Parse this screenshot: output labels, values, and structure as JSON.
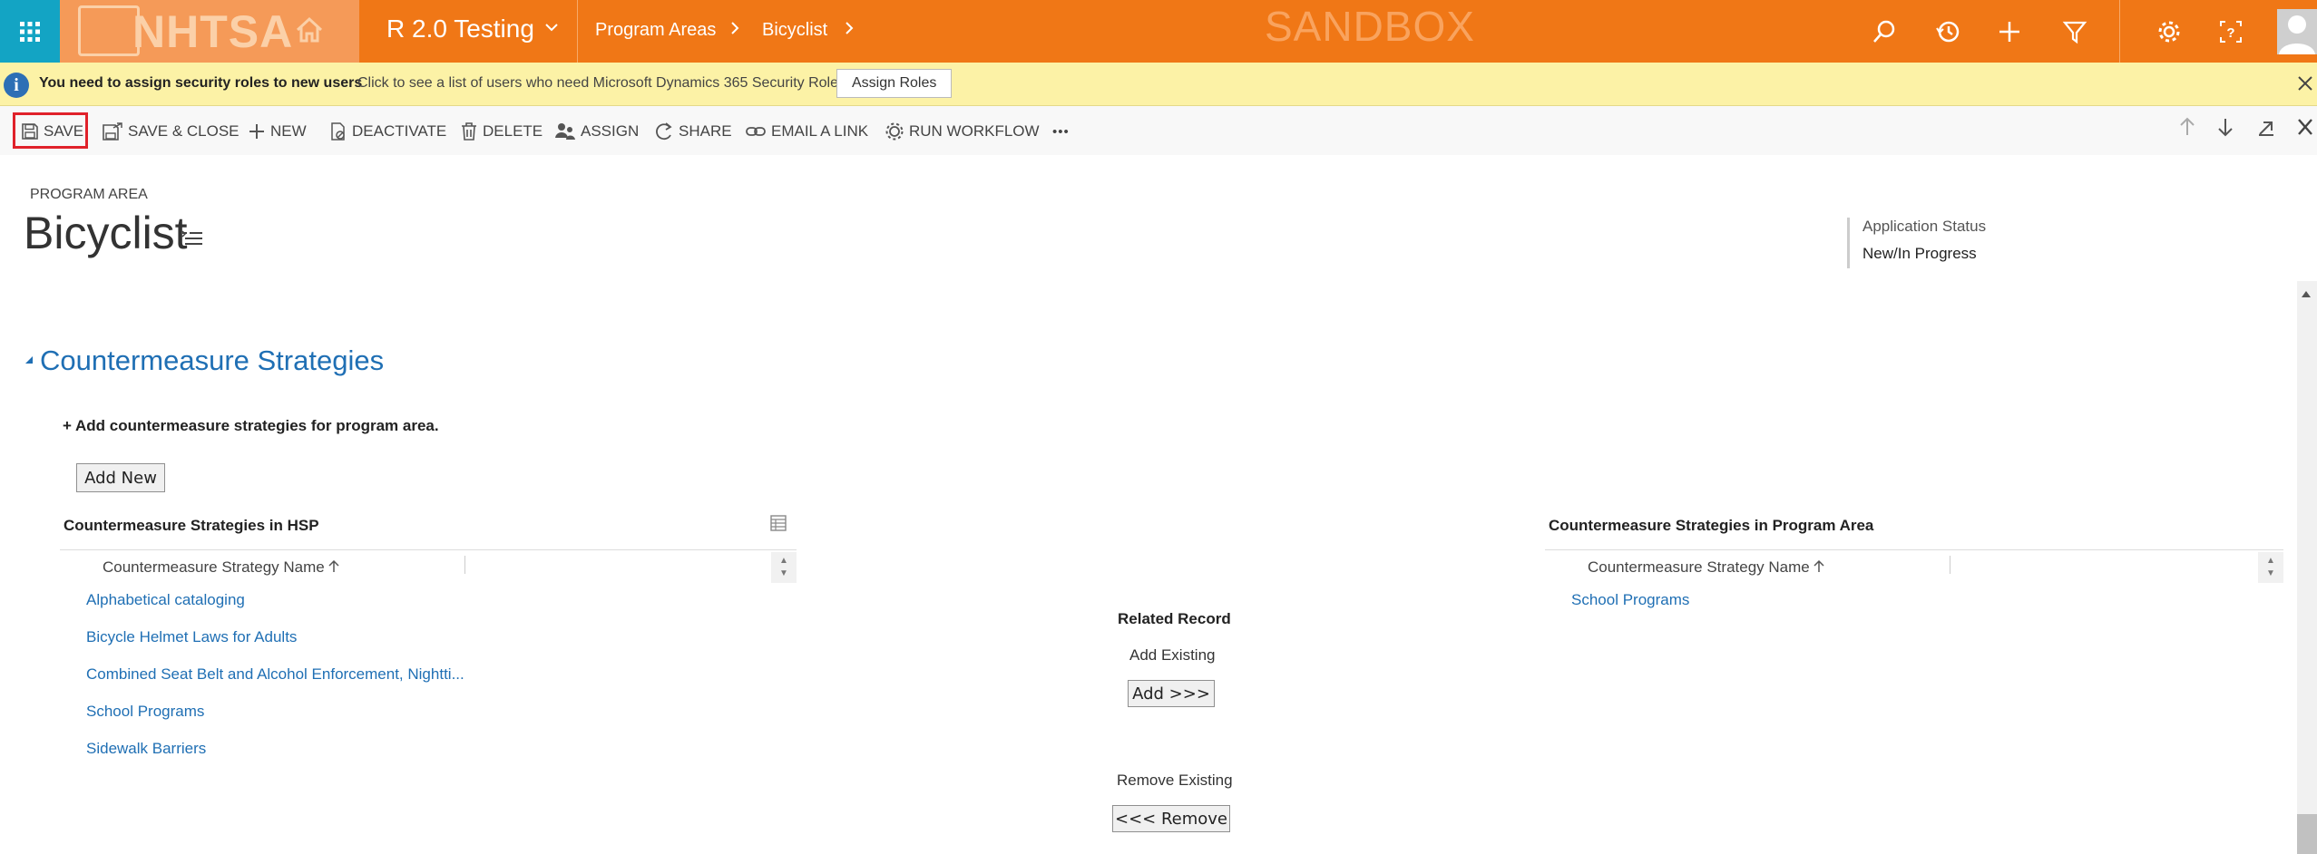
{
  "topbar": {
    "logo_text": "NHTSA",
    "environment": "R 2.0 Testing",
    "breadcrumb": [
      "Program Areas",
      "Bicyclist"
    ],
    "watermark": "SANDBOX",
    "colors": {
      "bar": "#f07716",
      "waffle": "#13a4c4",
      "logo_bg": "#f59a58"
    },
    "icons": [
      "waffle-icon",
      "home-icon",
      "search-icon",
      "history-icon",
      "plus-icon",
      "filter-icon",
      "gear-icon",
      "help-icon",
      "user-avatar-icon"
    ]
  },
  "notification": {
    "message": "You need to assign security roles to new users",
    "detail": "Click to see a list of users who need Microsoft Dynamics 365 Security Roles.",
    "button": "Assign Roles"
  },
  "commandbar": {
    "save": "SAVE",
    "save_close": "SAVE & CLOSE",
    "new": "NEW",
    "deactivate": "DEACTIVATE",
    "delete": "DELETE",
    "assign": "ASSIGN",
    "share": "SHARE",
    "email_link": "EMAIL A LINK",
    "run_workflow": "RUN WORKFLOW",
    "more": "•••"
  },
  "form": {
    "entity_label": "PROGRAM AREA",
    "title": "Bicyclist",
    "header_field": {
      "label": "Application Status",
      "value": "New/In Progress"
    }
  },
  "section": {
    "title": "Countermeasure Strategies",
    "hint": "+ Add countermeasure strategies for program area.",
    "add_new": "Add New"
  },
  "grid_hsp": {
    "title": "Countermeasure Strategies in HSP",
    "column": "Countermeasure Strategy Name",
    "rows": [
      "Alphabetical cataloging",
      "Bicycle Helmet Laws for Adults",
      "Combined Seat Belt and Alcohol Enforcement, Nightti...",
      "School Programs",
      "Sidewalk Barriers"
    ]
  },
  "related": {
    "title": "Related Record",
    "add_label": "Add Existing",
    "add_button": "Add >>>",
    "remove_label": "Remove Existing",
    "remove_button": "<<< Remove"
  },
  "grid_program_area": {
    "title": "Countermeasure Strategies in Program Area",
    "column": "Countermeasure Strategy Name",
    "rows": [
      "School Programs"
    ]
  }
}
